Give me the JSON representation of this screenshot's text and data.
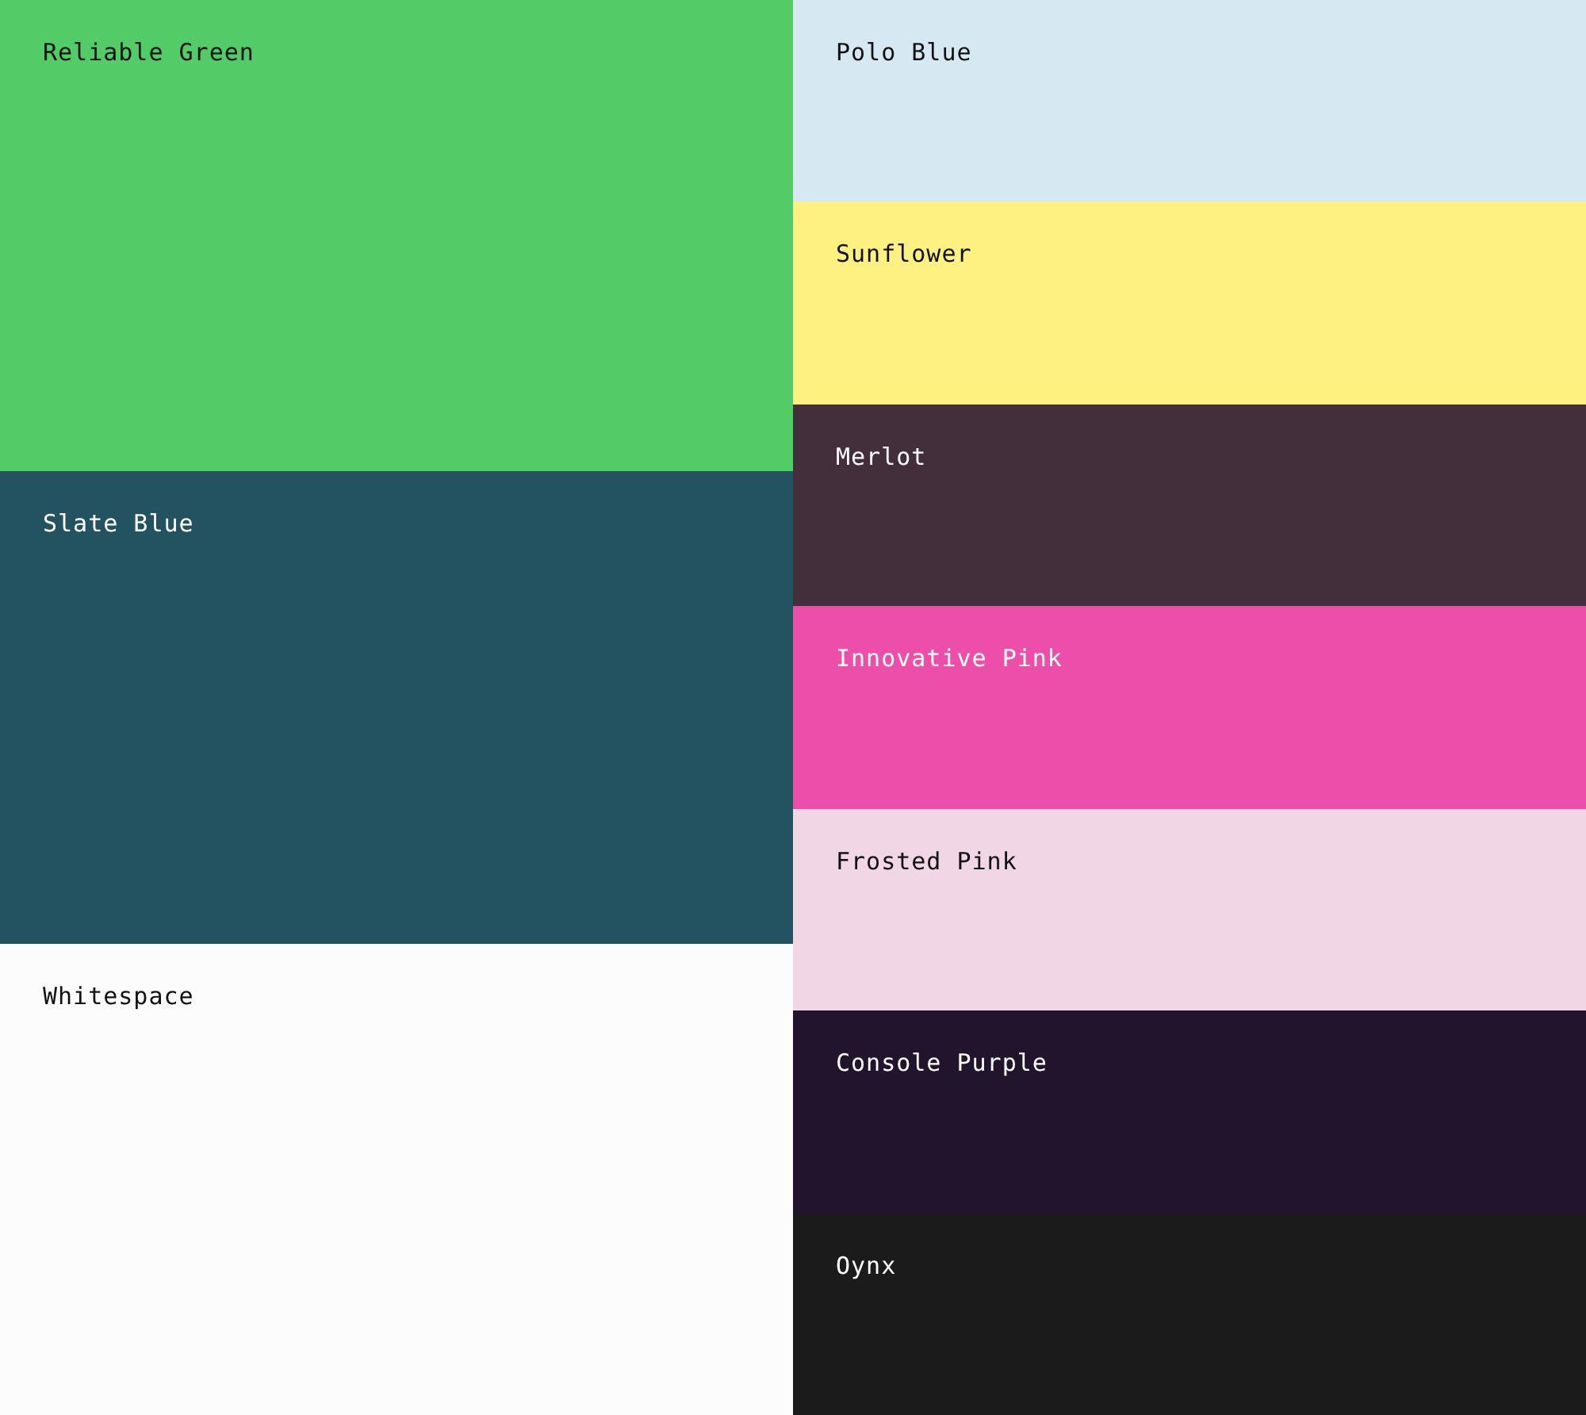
{
  "palette": {
    "primary": [
      {
        "name": "Reliable Green",
        "color": "#53cc67"
      },
      {
        "name": "Slate Blue",
        "color": "#235360"
      },
      {
        "name": "Whitespace",
        "color": "#fcfcfc"
      }
    ],
    "secondary": [
      {
        "name": "Polo Blue",
        "color": "#d6e9f3"
      },
      {
        "name": "Sunflower",
        "color": "#fef081"
      },
      {
        "name": "Merlot",
        "color": "#432e3b"
      },
      {
        "name": "Innovative Pink",
        "color": "#ec4eaa"
      },
      {
        "name": "Frosted Pink",
        "color": "#f1d6e5"
      },
      {
        "name": "Console Purple",
        "color": "#21142c"
      },
      {
        "name": "Oynx",
        "color": "#1b1b1b"
      }
    ]
  }
}
